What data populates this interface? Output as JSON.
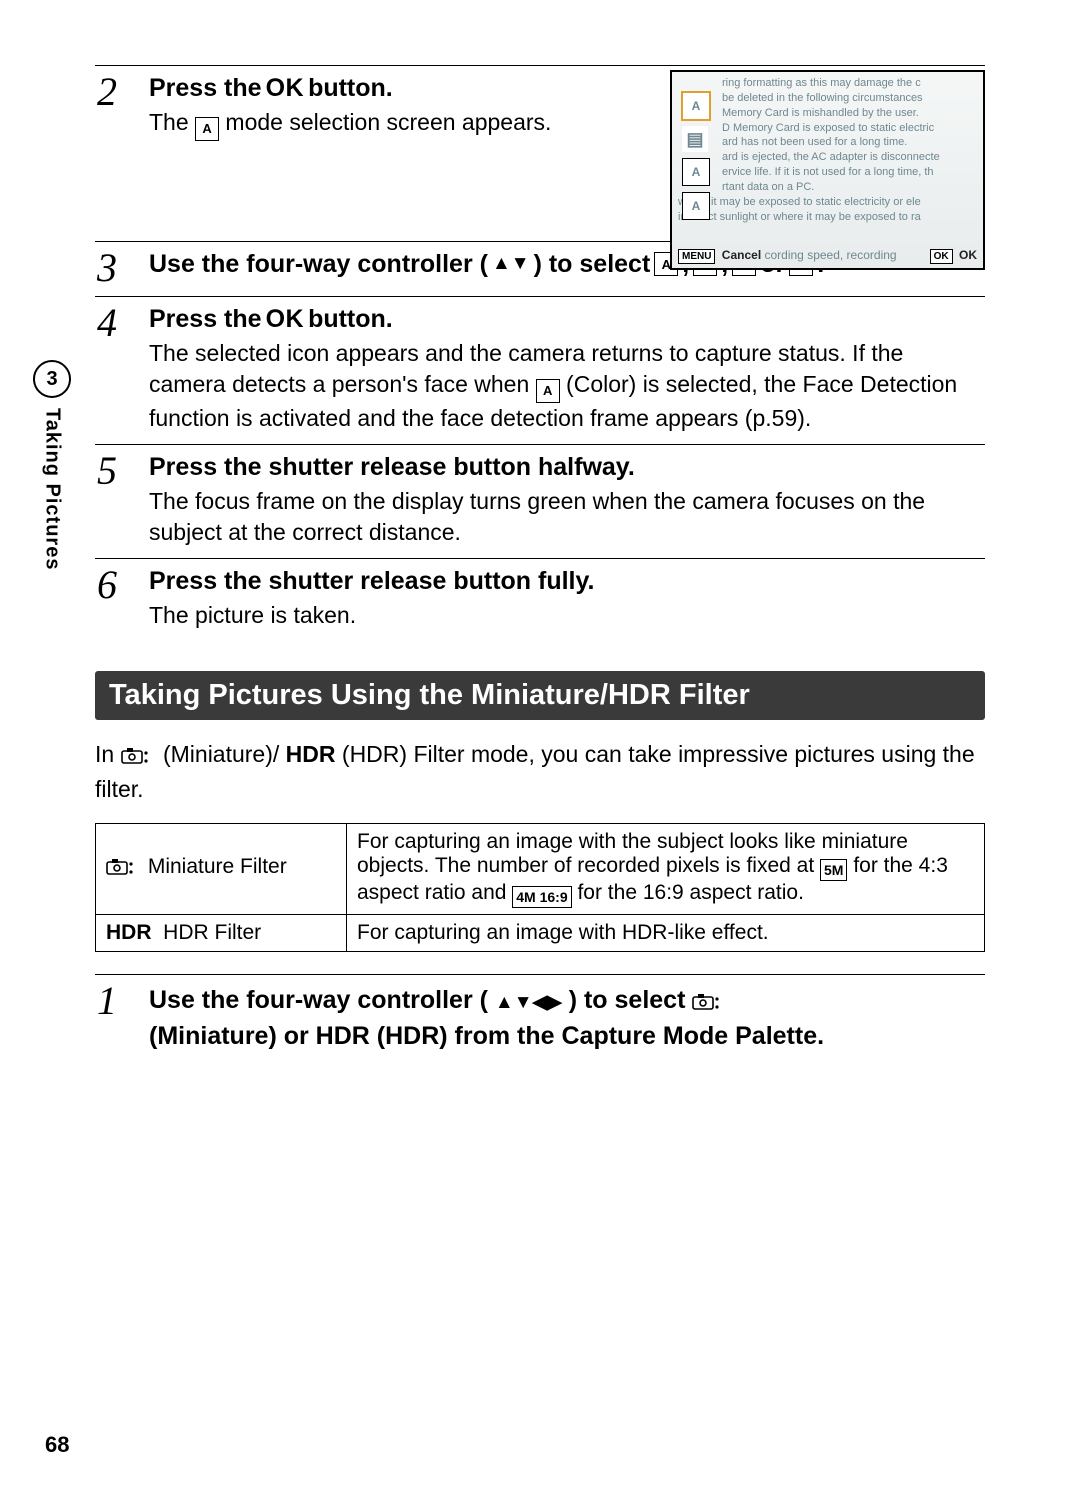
{
  "sideTab": {
    "chapter": "3",
    "label": "Taking Pictures"
  },
  "steps": {
    "s2": {
      "num": "2",
      "heading_pre": "Press the ",
      "heading_button": "OK",
      "heading_post": " button.",
      "desc_pre": "The ",
      "desc_icon": "A",
      "desc_post": " mode selection screen appears."
    },
    "s3": {
      "num": "3",
      "heading_pre": "Use the four-way controller (",
      "heading_arrows": "▲▼",
      "heading_mid": ") to select ",
      "icon": "A",
      "sep1": ", ",
      "sep2": ", ",
      "or": " or ",
      "period": "."
    },
    "s4": {
      "num": "4",
      "heading_pre": "Press the ",
      "heading_button": "OK",
      "heading_post": " button.",
      "desc_line1": "The selected icon appears and the camera returns to capture status. If the camera detects a person's face when ",
      "desc_icon": "A",
      "desc_line2": " (Color) is selected, the Face Detection function is activated and the face detection frame appears (p.59)."
    },
    "s5": {
      "num": "5",
      "heading": "Press the shutter release button halfway.",
      "desc": "The focus frame on the display turns green when the camera focuses on the subject at the correct distance."
    },
    "s6": {
      "num": "6",
      "heading": "Press the shutter release button fully.",
      "desc": "The picture is taken."
    }
  },
  "lcd": {
    "lines": [
      "ring formatting as this may damage the c",
      "be deleted in the following circumstances",
      "Memory Card is mishandled by the user.",
      "D Memory Card is exposed to static electric",
      "ard has not been used for a long time.",
      "ard is ejected, the AC adapter is disconnecte",
      "ervice life. If it is not used for a long time, th",
      "rtant data on a PC.",
      "where it may be exposed to static electricity or ele",
      "in direct sunlight or where it may be exposed to ra"
    ],
    "footer_menu": "MENU",
    "footer_cancel": "Cancel",
    "footer_mid": "cording speed, recording",
    "footer_ok_box": "OK",
    "footer_ok": "OK"
  },
  "section": {
    "title": "Taking Pictures Using the Miniature/HDR Filter",
    "intro_pre": "In ",
    "intro_paren1": " (Miniature)/",
    "intro_hdr": "HDR",
    "intro_post": " (HDR) Filter mode, you can take impressive pictures using the filter."
  },
  "filterTable": {
    "row1": {
      "name": "Miniature Filter",
      "desc_pre": "For capturing an image with the subject looks like miniature objects. The number of recorded pixels is fixed at ",
      "box1": "5M",
      "desc_mid": " for the 4:3 aspect ratio and ",
      "box2": "4M 16:9",
      "desc_post": " for the 16:9 aspect ratio."
    },
    "row2": {
      "hdr": "HDR",
      "name": "HDR Filter",
      "desc": "For capturing an image with HDR-like effect."
    }
  },
  "step1": {
    "num": "1",
    "line_pre": "Use the four-way controller (",
    "arrows": "▲▼◀▶",
    "line_mid": ") to select ",
    "line2_pre": "(Miniature) or ",
    "hdr": "HDR",
    "line2_post": " (HDR) from the Capture Mode Palette."
  },
  "pageNum": "68"
}
